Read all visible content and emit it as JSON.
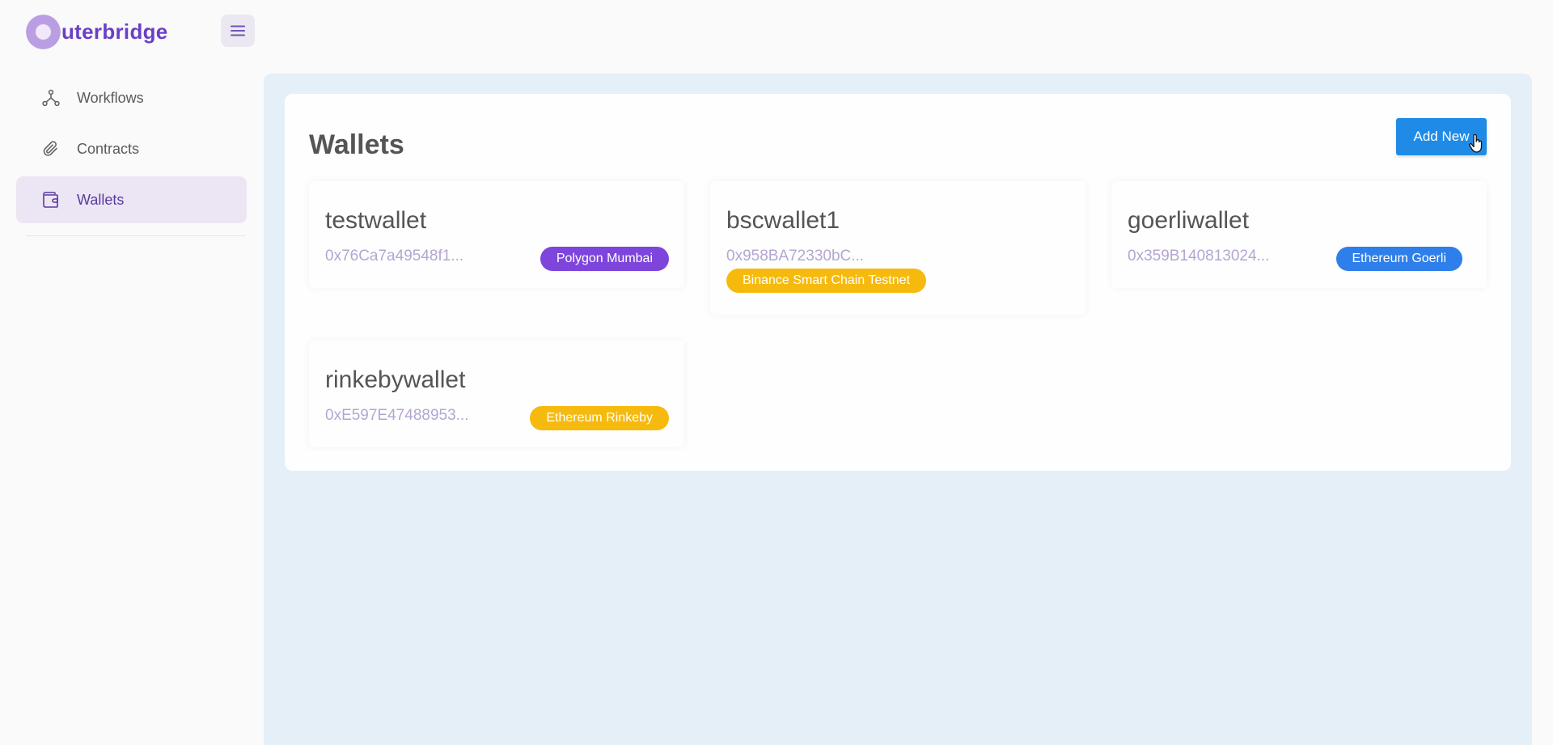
{
  "app": {
    "logo_text": "uterbridge",
    "brand_color": "#6a3fc8"
  },
  "sidebar": {
    "items": [
      {
        "label": "Workflows",
        "icon": "workflow-icon",
        "active": false
      },
      {
        "label": "Contracts",
        "icon": "paperclip-icon",
        "active": false
      },
      {
        "label": "Wallets",
        "icon": "wallet-icon",
        "active": true
      }
    ]
  },
  "main": {
    "title": "Wallets",
    "add_button": "Add New",
    "wallets": [
      {
        "name": "testwallet",
        "address": "0x76Ca7a49548f1...",
        "network": "Polygon Mumbai",
        "network_color": "#7e45dc"
      },
      {
        "name": "bscwallet1",
        "address": "0x958BA72330bC...",
        "network": "Binance Smart Chain Testnet",
        "network_color": "#f6ba0e"
      },
      {
        "name": "goerliwallet",
        "address": "0x359B140813024...",
        "network": "Ethereum Goerli",
        "network_color": "#2f7fea"
      },
      {
        "name": "rinkebywallet",
        "address": "0xE597E47488953...",
        "network": "Ethereum Rinkeby",
        "network_color": "#f6ba0e"
      }
    ]
  }
}
